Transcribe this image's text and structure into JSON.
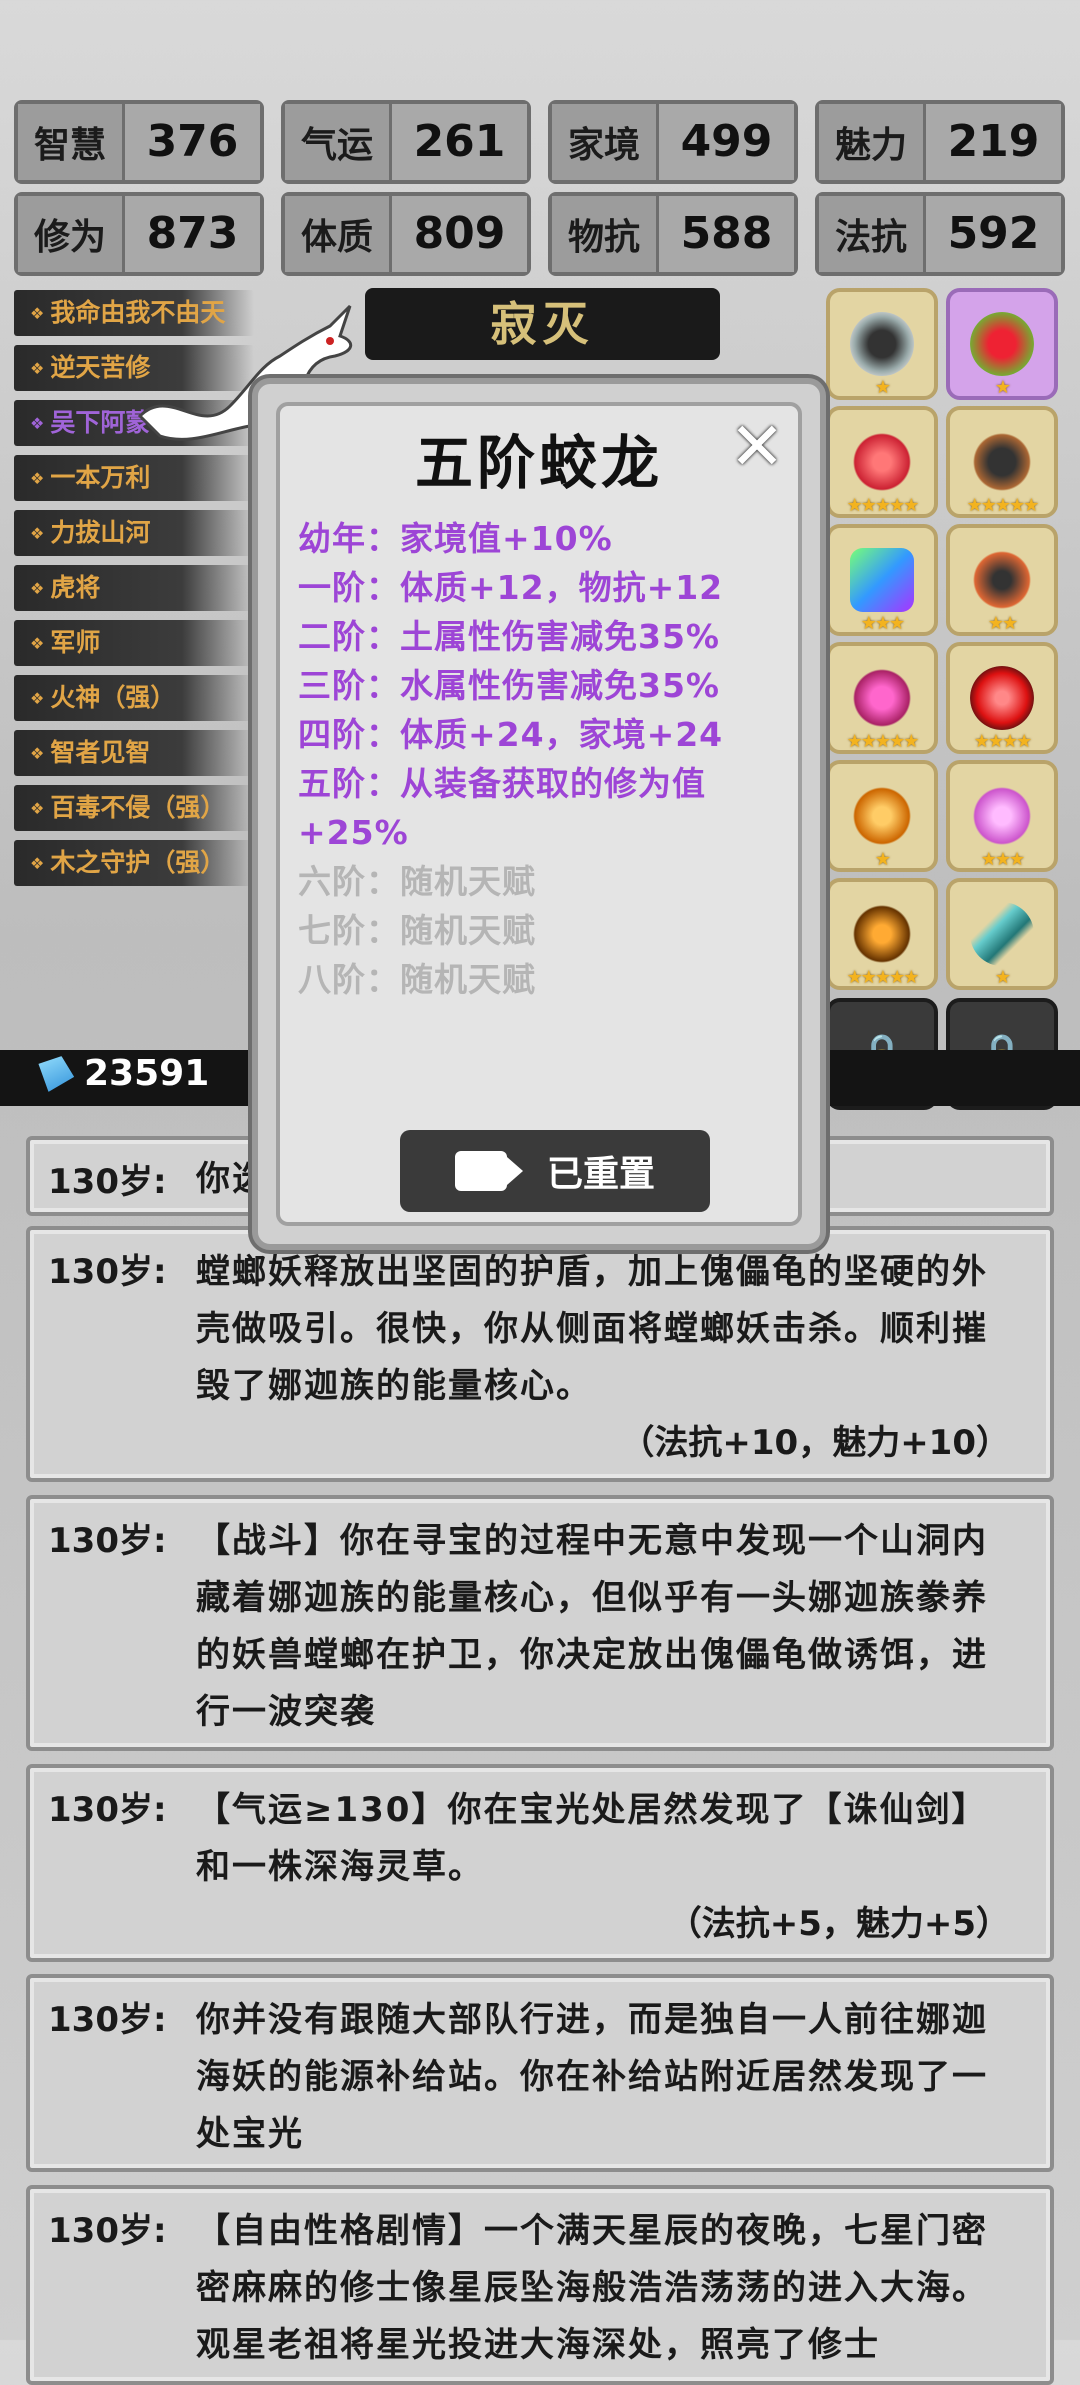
{
  "stats": [
    {
      "label": "智慧",
      "value": "376"
    },
    {
      "label": "气运",
      "value": "261"
    },
    {
      "label": "家境",
      "value": "499"
    },
    {
      "label": "魅力",
      "value": "219"
    },
    {
      "label": "修为",
      "value": "873"
    },
    {
      "label": "体质",
      "value": "809"
    },
    {
      "label": "物抗",
      "value": "588"
    },
    {
      "label": "法抗",
      "value": "592"
    }
  ],
  "talents": [
    "我命由我不由天",
    "逆天苦修",
    "吴下阿蒙",
    "一本万利",
    "力拔山河",
    "虎将",
    "军师",
    "火神（强）",
    "智者见智",
    "百毒不侵（强）",
    "木之守护（强）"
  ],
  "banner": "寂灭",
  "currency": "23591",
  "modal": {
    "title": "五阶蛟龙",
    "levels_active": [
      "幼年：家境值+10%",
      "一阶：体质+12，物抗+12",
      "二阶：土属性伤害减免35%",
      "三阶：水属性伤害减免35%",
      "四阶：体质+24，家境+24",
      "五阶：从装备获取的修为值+25%"
    ],
    "levels_locked": [
      "六阶：随机天赋",
      "七阶：随机天赋",
      "八阶：随机天赋"
    ],
    "reset_label": "已重置"
  },
  "logs": [
    {
      "age": "130岁:",
      "text": "你选",
      "bonus": ""
    },
    {
      "age": "130岁:",
      "text": "螳螂妖释放出坚固的护盾，加上傀儡龟的坚硬的外壳做吸引。很快，你从侧面将螳螂妖击杀。顺利摧毁了娜迦族的能量核心。",
      "bonus": "（法抗+10，魅力+10）"
    },
    {
      "age": "130岁:",
      "text": "【战斗】你在寻宝的过程中无意中发现一个山洞内藏着娜迦族的能量核心，但似乎有一头娜迦族豢养的妖兽螳螂在护卫，你决定放出傀儡龟做诱饵，进行一波突袭",
      "bonus": ""
    },
    {
      "age": "130岁:",
      "text": "【气运≥130】你在宝光处居然发现了【诛仙剑】和一株深海灵草。",
      "bonus": "（法抗+5，魅力+5）"
    },
    {
      "age": "130岁:",
      "text": "你并没有跟随大部队行进，而是独自一人前往娜迦海妖的能源补给站。你在补给站附近居然发现了一处宝光",
      "bonus": ""
    },
    {
      "age": "130岁:",
      "text": "【自由性格剧情】一个满天星辰的夜晚，七星门密密麻麻的修士像星辰坠海般浩浩荡荡的进入大海。观星老祖将星光投进大海深处，照亮了修士",
      "bonus": ""
    }
  ]
}
